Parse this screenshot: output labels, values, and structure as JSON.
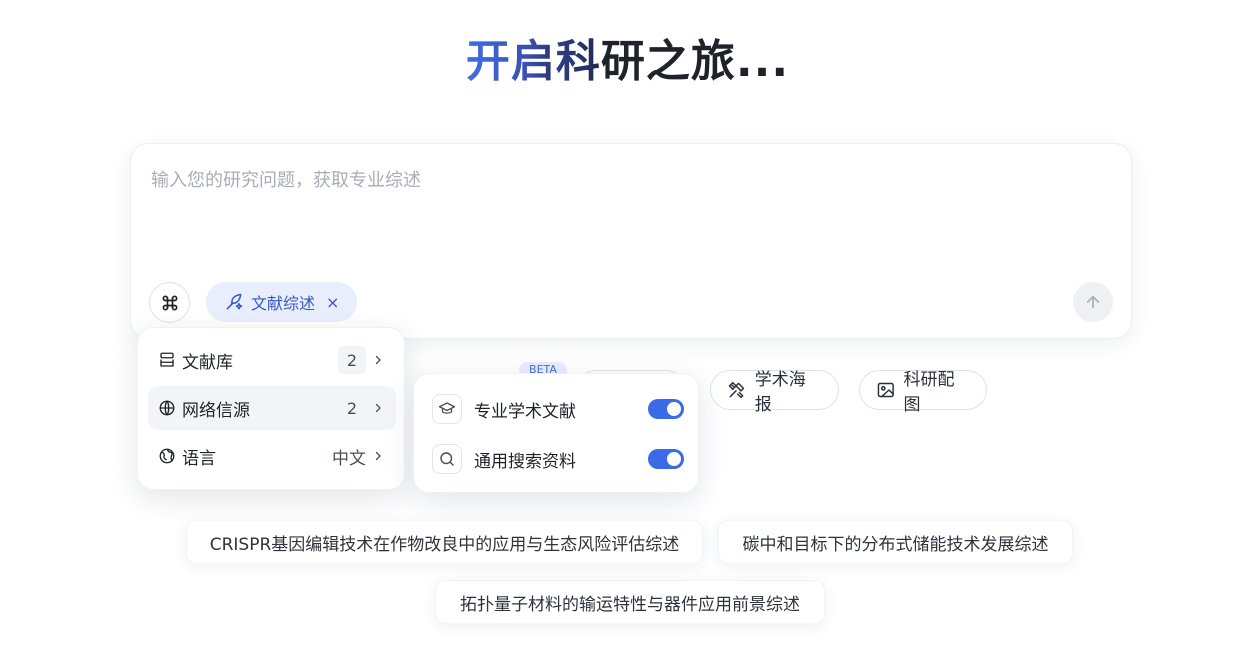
{
  "hero": {
    "title_part1": "开启",
    "title_part2": "科",
    "title_part3": "研之旅..."
  },
  "input": {
    "placeholder": "输入您的研究问题，获取专业综述",
    "value": ""
  },
  "mode_chip": {
    "label": "文献综述",
    "close": "×"
  },
  "tools": {
    "beta_badge": "BETA",
    "poster_label": "学术海报",
    "figure_label": "科研配图"
  },
  "menu": {
    "items": [
      {
        "label": "文献库",
        "count": "2",
        "icon": "library-icon"
      },
      {
        "label": "网络信源",
        "count": "2",
        "icon": "globe-icon"
      },
      {
        "label": "语言",
        "value": "中文",
        "icon": "language-icon"
      }
    ]
  },
  "submenu": {
    "items": [
      {
        "label": "专业学术文献",
        "enabled": true,
        "icon": "graduation-cap-icon"
      },
      {
        "label": "通用搜索资料",
        "enabled": true,
        "icon": "search-icon"
      }
    ]
  },
  "suggestions": [
    "CRISPR基因编辑技术在作物改良中的应用与生态风险评估综述",
    "碳中和目标下的分布式储能技术发展综述",
    "拓扑量子材料的输运特性与器件应用前景综述"
  ],
  "colors": {
    "accent": "#3a6ae6",
    "chip_bg": "#e9eefd",
    "chip_text": "#3459c8"
  }
}
